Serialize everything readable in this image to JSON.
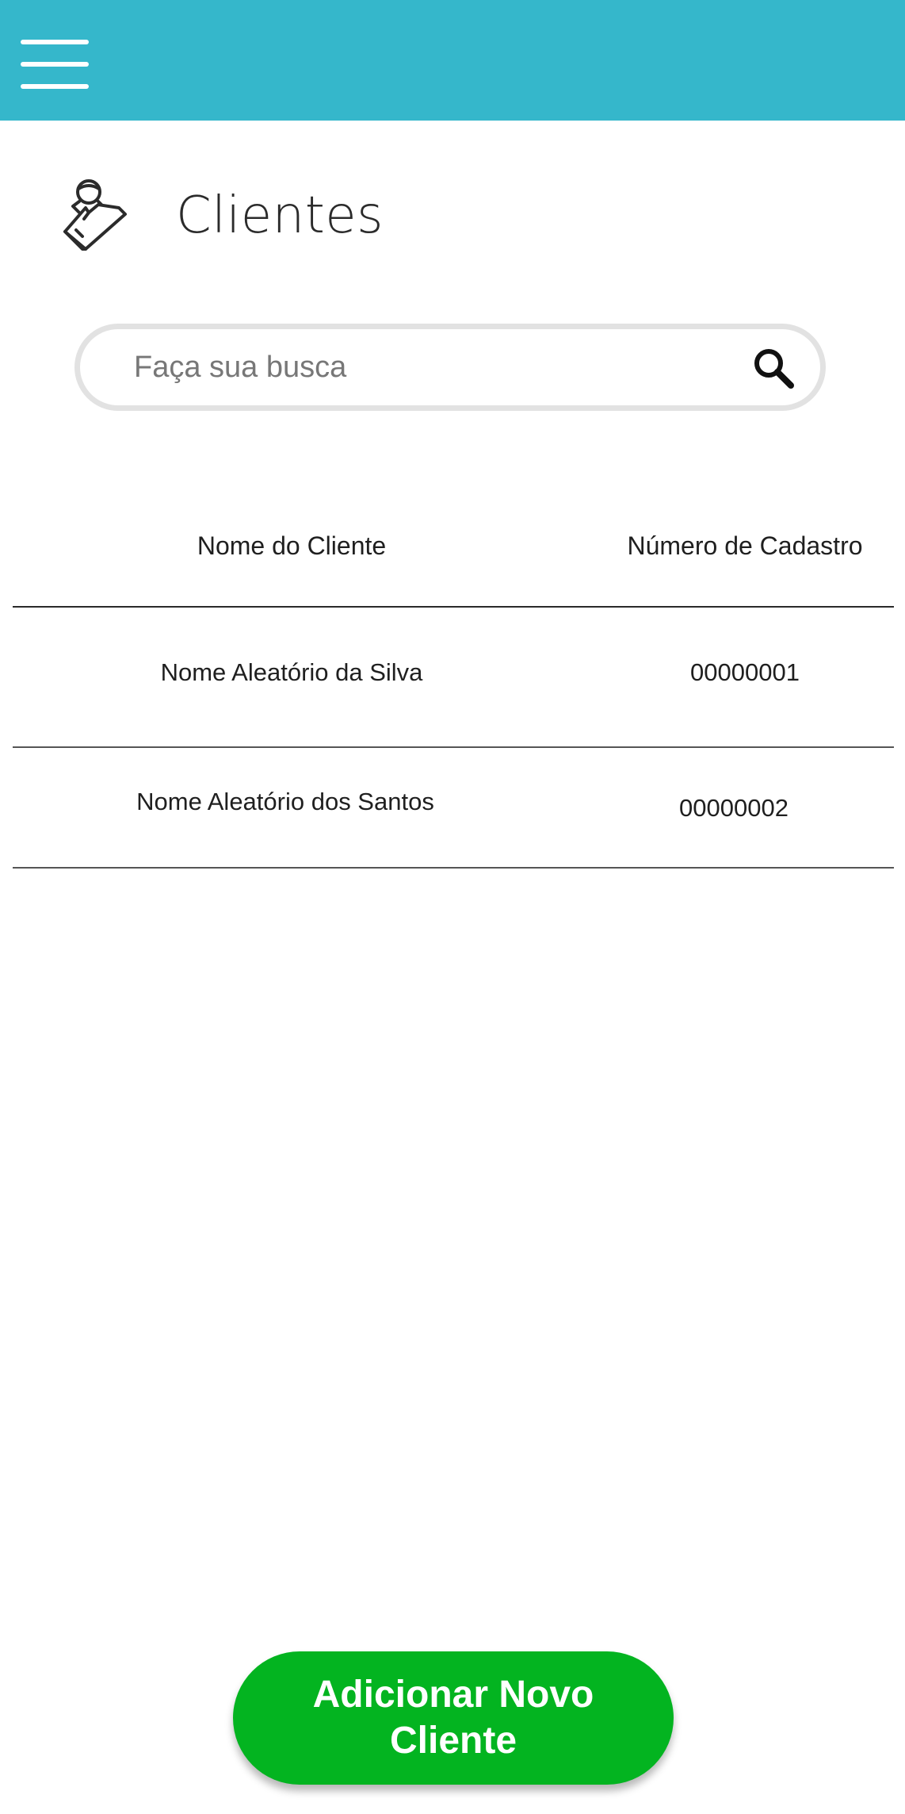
{
  "colors": {
    "header_bar": "#35b7cb",
    "primary_button": "#03b420",
    "search_border": "#e2e2e2"
  },
  "header": {
    "menu_icon": "hamburger-menu-icon"
  },
  "page": {
    "icon": "client-handshake-icon",
    "title": "Clientes"
  },
  "search": {
    "placeholder": "Faça sua busca",
    "value": "",
    "icon": "search-icon"
  },
  "table": {
    "columns": [
      "Nome do Cliente",
      "Número de Cadastro"
    ],
    "rows": [
      {
        "name": "Nome Aleatório da Silva",
        "number": "00000001"
      },
      {
        "name": "Nome Aleatório dos Santos",
        "number": "00000002"
      }
    ]
  },
  "actions": {
    "add_label": "Adicionar Novo Cliente"
  }
}
